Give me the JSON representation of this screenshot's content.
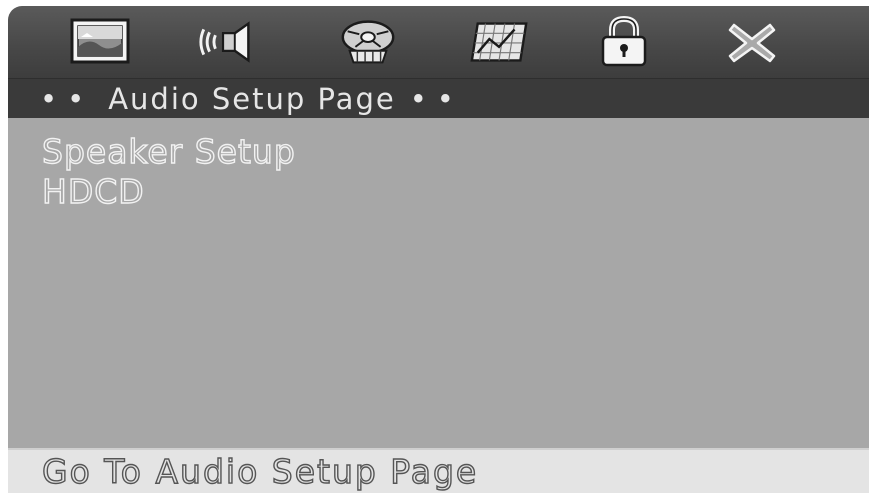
{
  "toolbar": {
    "icons": [
      {
        "name": "general-setup-icon"
      },
      {
        "name": "audio-setup-icon"
      },
      {
        "name": "video-setup-icon"
      },
      {
        "name": "preference-setup-icon"
      },
      {
        "name": "password-setup-icon"
      },
      {
        "name": "exit-setup-icon"
      }
    ]
  },
  "title": {
    "text": "Audio Setup Page",
    "dots_left": "••",
    "dots_right": "••"
  },
  "menu": {
    "items": [
      {
        "label": "Speaker Setup"
      },
      {
        "label": "HDCD"
      }
    ]
  },
  "status": {
    "text": "Go To Audio Setup Page"
  },
  "colors": {
    "background": "#a6a6a6",
    "iconbar": "#4a4a4a",
    "titlebar": "#3a3a3a",
    "statusbar": "#e4e4e4"
  }
}
